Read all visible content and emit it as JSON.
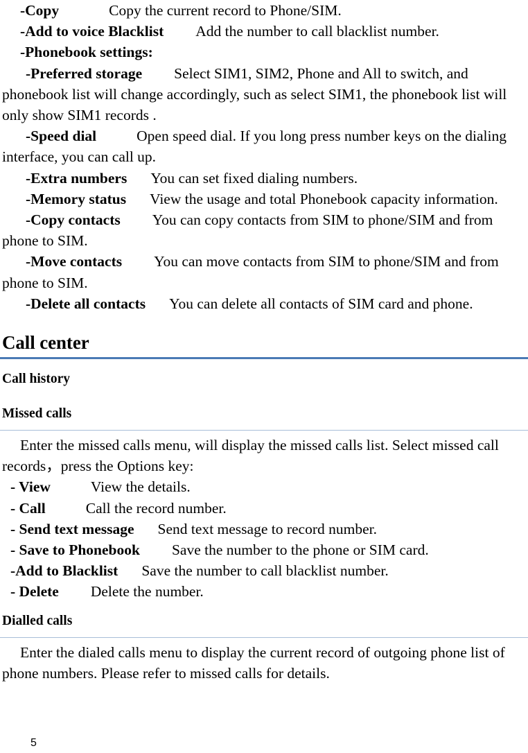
{
  "document": {
    "page_number": "5"
  },
  "phonebook_options": [
    {
      "label": "-Copy",
      "gap": "gap-xxl",
      "description": "Copy the current record to Phone/SIM.",
      "indent": "entry"
    },
    {
      "label": "-Add to voice Blacklist",
      "gap": "gap-lg",
      "description": "Add the number to call blacklist number.",
      "indent": "entry"
    },
    {
      "label": "-Phonebook settings:",
      "gap": "gap-sm",
      "description": "",
      "indent": "entry"
    }
  ],
  "phonebook_settings": [
    {
      "label": "-Preferred storage",
      "gap": "gap-lg",
      "description": "Select SIM1, SIM2, Phone and All to switch, and phonebook list will change accordingly, such as select SIM1, the phonebook list will only show SIM1 records ."
    },
    {
      "label": "-Speed dial",
      "gap": "gap-xl",
      "description": "Open speed dial. If you long press number keys on the dialing interface, you can call up."
    },
    {
      "label": "-Extra numbers",
      "gap": "gap-md",
      "description": "You can set fixed dialing numbers."
    },
    {
      "label": "-Memory status",
      "gap": "gap-md",
      "description": "View the usage and total Phonebook capacity information."
    },
    {
      "label": "-Copy contacts",
      "gap": "gap-lg",
      "description": "You can copy contacts from SIM to phone/SIM and from phone to SIM."
    },
    {
      "label": "-Move contacts",
      "gap": "gap-lg",
      "description": "You can move contacts from SIM to phone/SIM and from phone to SIM."
    },
    {
      "label": "-Delete all contacts",
      "gap": "gap-md",
      "description": "You can delete all contacts of SIM card and phone."
    }
  ],
  "call_center": {
    "title": "Call center",
    "call_history_title": "Call history",
    "missed_calls": {
      "title": "Missed calls",
      "intro": "Enter the missed calls menu, will display the missed calls list. Select missed call records，press the Options key:",
      "options": [
        {
          "label": "- View",
          "gap": "gap-xl",
          "description": "View the details."
        },
        {
          "label": "- Call",
          "gap": "gap-xl",
          "description": "Call the record number."
        },
        {
          "label": "- Send text message",
          "gap": "gap-md",
          "description": "Send text message to record number."
        },
        {
          "label": "- Save to Phonebook",
          "gap": "gap-lg",
          "description": "Save the number to the phone or SIM card."
        },
        {
          "label": "-Add to Blacklist",
          "gap": "gap-md",
          "description": "Save the number to call blacklist number."
        },
        {
          "label": "- Delete",
          "gap": "gap-lg",
          "description": "Delete the number."
        }
      ]
    },
    "dialled_calls": {
      "title": "Dialled calls",
      "body": "Enter the dialed calls menu to display the current record of outgoing phone list of phone numbers. Please refer to missed calls for details."
    }
  },
  "colors": {
    "major_rule": "#4a7ab5",
    "minor_rule": "#a8bdd8",
    "text": "#000000"
  }
}
